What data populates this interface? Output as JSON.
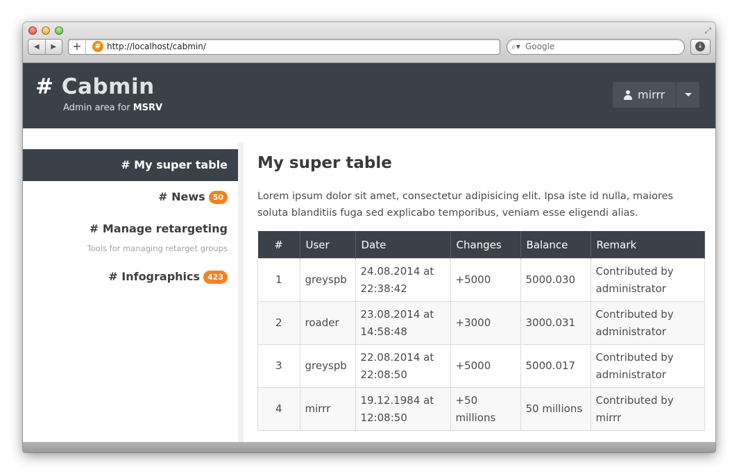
{
  "browser": {
    "url": "http://localhost/cabmin/",
    "search_placeholder": "Google"
  },
  "header": {
    "brand_hash": "#",
    "brand_name": "Cabmin",
    "tagline_prefix": "Admin area for",
    "tagline_site": "MSRV",
    "user_name": "mirrr"
  },
  "sidebar": {
    "items": [
      {
        "label": "# My super table",
        "active": true
      },
      {
        "label": "# News",
        "badge": "50"
      },
      {
        "label": "# Manage retargeting",
        "subtitle": "Tools for managing retarget groups"
      },
      {
        "label": "# Infographics",
        "badge": "423"
      }
    ]
  },
  "main": {
    "title": "My super table",
    "lead": "Lorem ipsum dolor sit amet, consectetur adipisicing elit. Ipsa iste id nulla, maiores soluta blanditiis fuga sed explicabo temporibus, veniam esse eligendi alias.",
    "table": {
      "headers": [
        "#",
        "User",
        "Date",
        "Changes",
        "Balance",
        "Remark"
      ],
      "rows": [
        [
          "1",
          "greyspb",
          "24.08.2014 at 22:38:42",
          "+5000",
          "5000.030",
          "Contributed by administrator"
        ],
        [
          "2",
          "roader",
          "23.08.2014 at 14:58:48",
          "+3000",
          "3000.031",
          "Contributed by administrator"
        ],
        [
          "3",
          "greyspb",
          "22.08.2014 at 22:08:50",
          "+5000",
          "5000.017",
          "Contributed by administrator"
        ],
        [
          "4",
          "mirrr",
          "19.12.1984 at 12:08:50",
          "+50 millions",
          "50 millions",
          "Contributed by mirrr"
        ]
      ]
    }
  },
  "colors": {
    "header_bg": "#3b4148",
    "badge": "#f58220"
  }
}
